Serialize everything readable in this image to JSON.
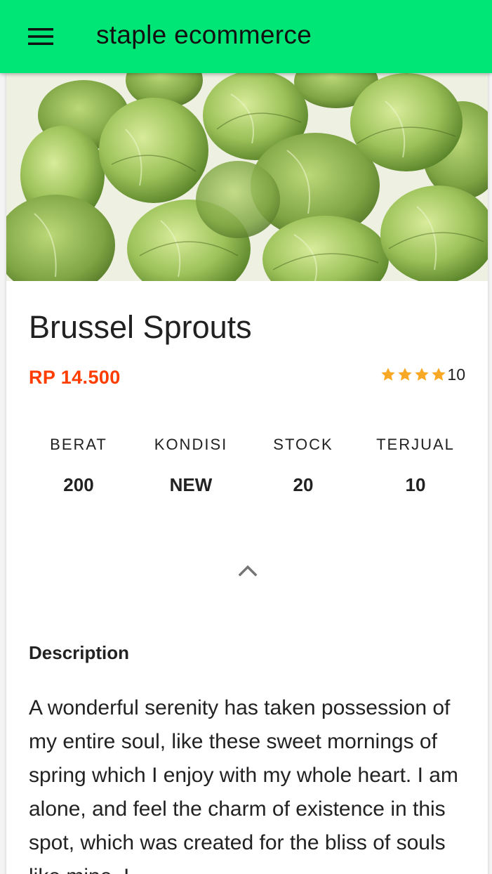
{
  "appbar": {
    "title": "staple ecommerce",
    "menu_icon": "hamburger-menu-icon",
    "background": "#00e676"
  },
  "product": {
    "image_alt": "Brussel Sprouts",
    "name": "Brussel Sprouts",
    "price": "RP 14.500",
    "price_color": "#ff3d00",
    "rating": {
      "stars": 4,
      "star_color": "#f9a825",
      "count": "10"
    }
  },
  "stats": [
    {
      "label": "BERAT",
      "value": "200"
    },
    {
      "label": "KONDISI",
      "value": "NEW"
    },
    {
      "label": "STOCK",
      "value": "20"
    },
    {
      "label": "TERJUAL",
      "value": "10"
    }
  ],
  "collapse_icon": "chevron-up-icon",
  "description": {
    "heading": "Description",
    "text": "A wonderful serenity has taken possession of my entire soul, like these sweet mornings of spring which I enjoy with my whole heart. I am alone, and feel the charm of existence in this spot, which was created for the bliss of souls like mine. I"
  }
}
